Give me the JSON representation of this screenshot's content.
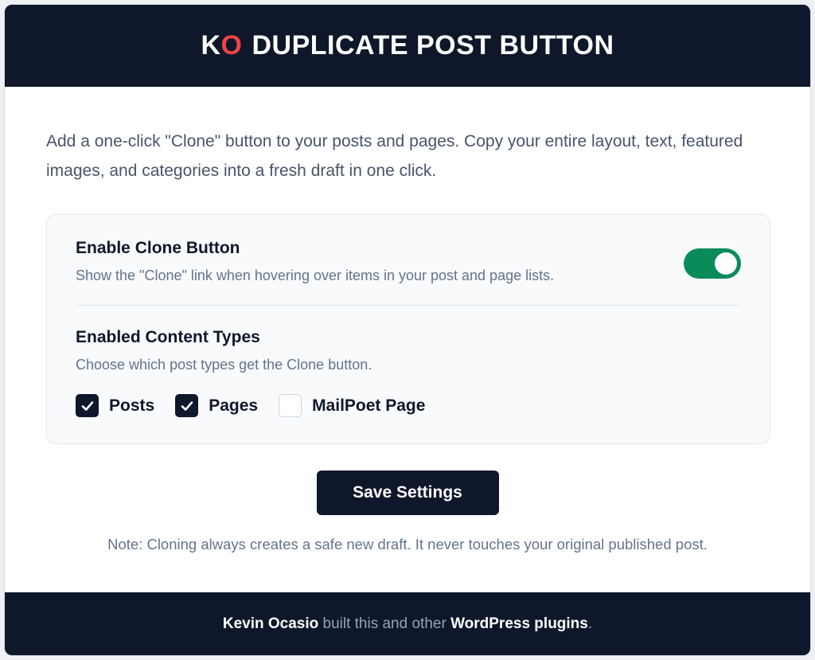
{
  "header": {
    "logo_k": "K",
    "logo_o": "O",
    "title": "DUPLICATE POST BUTTON"
  },
  "intro": "Add a one-click \"Clone\" button to your posts and pages. Copy your entire layout, text, featured images, and categories into a fresh draft in one click.",
  "enable_clone": {
    "title": "Enable Clone Button",
    "description": "Show the \"Clone\" link when hovering over items in your post and page lists.",
    "enabled": true,
    "toggle_color": "#0b8a5a"
  },
  "content_types": {
    "title": "Enabled Content Types",
    "description": "Choose which post types get the Clone button.",
    "items": [
      {
        "label": "Posts",
        "checked": true
      },
      {
        "label": "Pages",
        "checked": true
      },
      {
        "label": "MailPoet Page",
        "checked": false
      }
    ]
  },
  "save_label": "Save Settings",
  "note": "Note: Cloning always creates a safe new draft. It never touches your original published post.",
  "footer": {
    "author": "Kevin Ocasio",
    "middle": " built this and other ",
    "link": "WordPress plugins",
    "end": "."
  },
  "colors": {
    "dark": "#0f172a",
    "accent_red": "#ef4444",
    "toggle_green": "#0b8a5a"
  }
}
